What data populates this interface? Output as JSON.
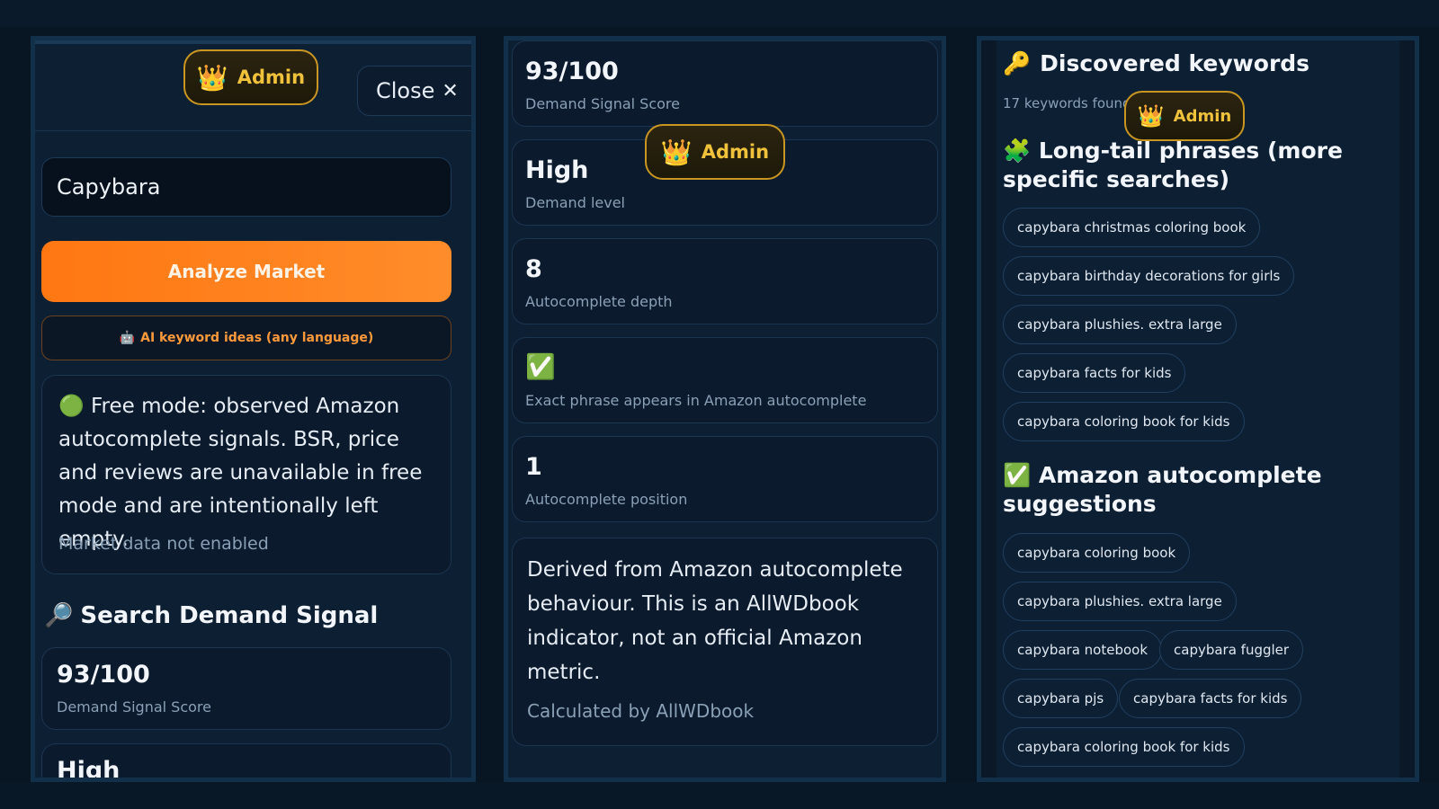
{
  "badges": {
    "admin_label": "Admin",
    "crown_icon": "👑"
  },
  "left_panel": {
    "close_label": "Close",
    "close_icon": "✕",
    "search_input_value": "Capybara",
    "analyze_button_label": "Analyze Market",
    "ai_ideas_icon": "🤖",
    "ai_ideas_label": "AI keyword ideas (any language)",
    "free_mode_icon": "🟢",
    "free_mode_text": "Free mode: observed Amazon autocomplete signals. BSR, price and reviews are unavailable in free mode and are intentionally left empty.",
    "market_data_note": "Market data not enabled",
    "section_icon": "🔎",
    "section_title": "Search Demand Signal",
    "score_value": "93/100",
    "score_label": "Demand Signal Score",
    "partial_next_value": "High"
  },
  "middle_panel": {
    "metrics": [
      {
        "value": "93/100",
        "label": "Demand Signal Score"
      },
      {
        "value": "High",
        "label": "Demand level"
      },
      {
        "value": "8",
        "label": "Autocomplete depth"
      },
      {
        "value": "✅",
        "label": "Exact phrase appears in Amazon autocomplete"
      },
      {
        "value": "1",
        "label": "Autocomplete position"
      }
    ],
    "note_text": "Derived from Amazon autocomplete behaviour. This is an AllWDbook indicator, not an official Amazon metric.",
    "calc_note": "Calculated by AllWDbook"
  },
  "right_panel": {
    "title_icon": "🔑",
    "title": "Discovered keywords",
    "count_text": "17 keywords found",
    "longtail_icon": "🧩",
    "longtail_title": "Long-tail phrases (more specific searches)",
    "longtail_chips": [
      "capybara christmas coloring book",
      "capybara birthday decorations for girls",
      "capybara plushies. extra large",
      "capybara facts for kids",
      "capybara coloring book for kids"
    ],
    "autocomplete_icon": "✅",
    "autocomplete_title": "Amazon autocomplete suggestions",
    "autocomplete_chips": [
      "capybara coloring book",
      "capybara plushies. extra large",
      "capybara notebook",
      "capybara fuggler",
      "capybara pjs",
      "capybara facts for kids",
      "capybara coloring book for kids"
    ]
  },
  "colors": {
    "accent_orange": "#ff7a1a",
    "gold": "#f0c23b",
    "background": "#081523"
  }
}
